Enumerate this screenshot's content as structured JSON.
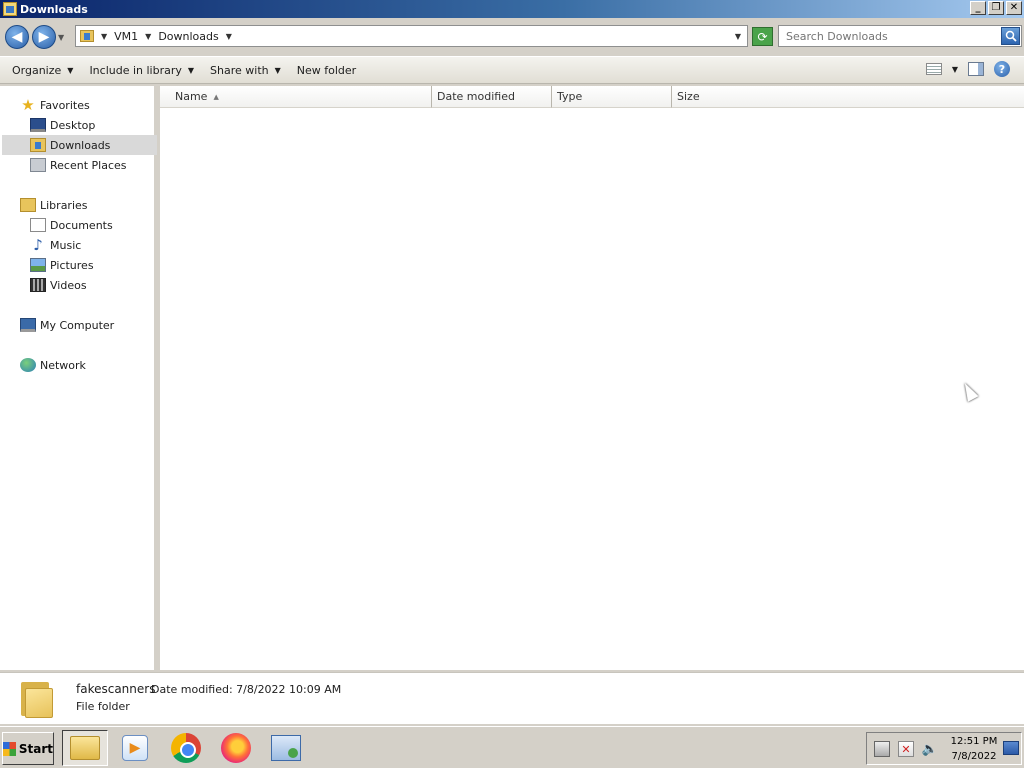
{
  "window": {
    "title": "Downloads",
    "controls": {
      "minimize": "_",
      "maximize": "❐",
      "close": "✕"
    }
  },
  "address": {
    "crumbs": [
      "VM1",
      "Downloads"
    ],
    "search_placeholder": "Search Downloads"
  },
  "commands": {
    "organize": "Organize",
    "include_in_library": "Include in library",
    "share_with": "Share with",
    "new_folder": "New folder"
  },
  "nav": {
    "favorites": "Favorites",
    "desktop": "Desktop",
    "downloads": "Downloads",
    "recent_places": "Recent Places",
    "libraries": "Libraries",
    "documents": "Documents",
    "music": "Music",
    "pictures": "Pictures",
    "videos": "Videos",
    "my_computer": "My Computer",
    "network": "Network",
    "selected": "Downloads"
  },
  "columns": [
    "Name",
    "Date modified",
    "Type",
    "Size"
  ],
  "files": [],
  "details": {
    "name": "fakescanners",
    "date_modified": "Date modified: 7/8/2022 10:09 AM",
    "type": "File folder"
  },
  "taskbar": {
    "start": "Start",
    "apps": [
      "windows-explorer",
      "media-player",
      "chrome",
      "firefox",
      "remote-desktop"
    ],
    "active_app": "windows-explorer"
  },
  "clock": {
    "time": "12:51 PM",
    "date": "7/8/2022"
  },
  "colors": {
    "titlebar_start": "#0a246a",
    "titlebar_end": "#a6caf0",
    "chrome_bg": "#d4d0c8",
    "selection": "#d9d9d9"
  }
}
